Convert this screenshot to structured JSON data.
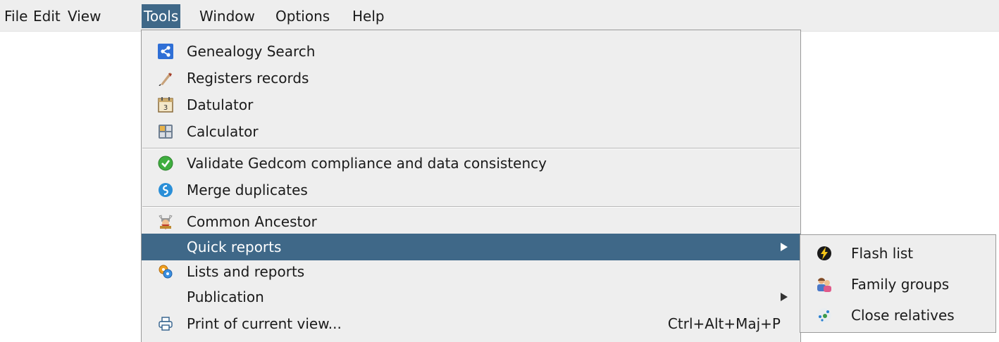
{
  "menubar": {
    "items": [
      {
        "label": "File"
      },
      {
        "label": "Edit"
      },
      {
        "label": "View"
      },
      {
        "label": "Tools"
      },
      {
        "label": "Window"
      },
      {
        "label": "Options"
      },
      {
        "label": "Help"
      }
    ]
  },
  "tools_menu": {
    "items": [
      {
        "label": "Genealogy Search",
        "icon": "share-icon"
      },
      {
        "label": "Registers records",
        "icon": "quill-pen-icon"
      },
      {
        "label": "Datulator",
        "icon": "calendar-icon"
      },
      {
        "label": "Calculator",
        "icon": "calculator-icon"
      },
      {
        "label": "Validate Gedcom compliance and data consistency",
        "icon": "check-circle-icon"
      },
      {
        "label": "Merge duplicates",
        "icon": "merge-icon"
      },
      {
        "label": "Common Ancestor",
        "icon": "viking-ancestor-icon"
      },
      {
        "label": "Quick reports",
        "submenu": true
      },
      {
        "label": "Lists and reports",
        "icon": "reports-icon"
      },
      {
        "label": "Publication",
        "submenu": true
      },
      {
        "label": "Print of current view...",
        "icon": "printer-icon",
        "shortcut": "Ctrl+Alt+Maj+P"
      }
    ]
  },
  "quick_reports_submenu": {
    "items": [
      {
        "label": "Flash list",
        "icon": "lightning-icon"
      },
      {
        "label": "Family groups",
        "icon": "family-icon"
      },
      {
        "label": "Close relatives",
        "icon": "relatives-icon"
      }
    ]
  },
  "colors": {
    "highlight": "#3f6888",
    "menu_background": "#eeeeee"
  }
}
